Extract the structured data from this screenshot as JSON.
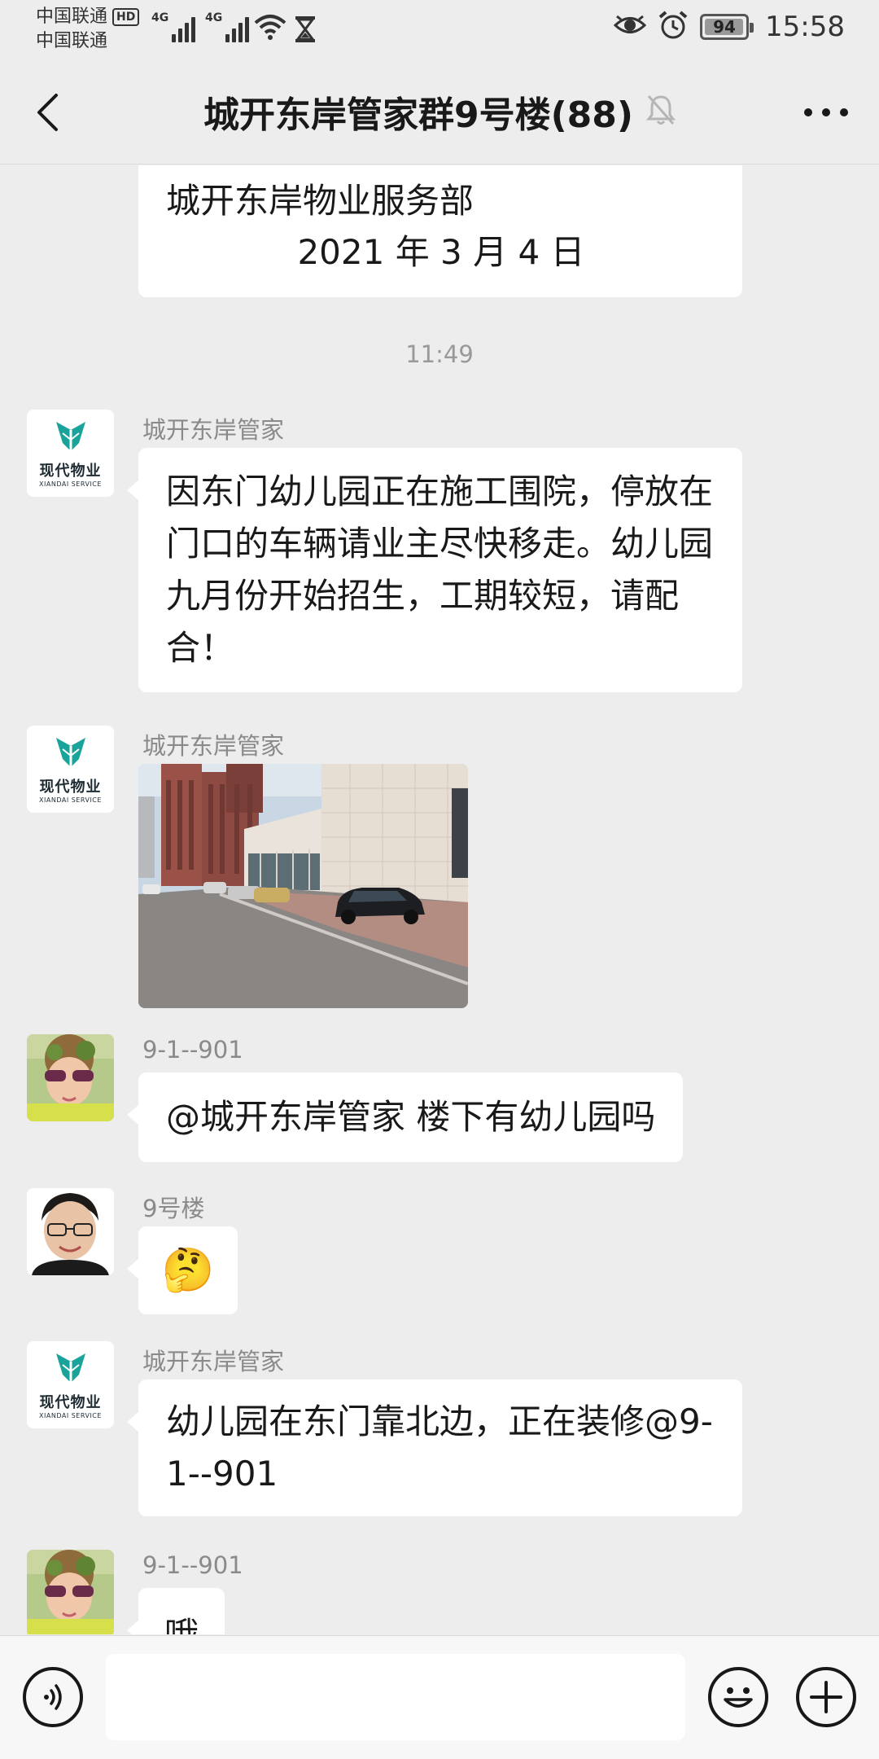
{
  "status_bar": {
    "carrier_1": "中国联通",
    "carrier_badge": "HD",
    "carrier_2": "中国联通",
    "network_1": "4G",
    "network_2": "4G",
    "battery_level": "94",
    "time": "15:58",
    "icons": [
      "signal-icon",
      "wifi-icon",
      "hourglass-icon",
      "eye-icon",
      "alarm-icon",
      "battery-icon"
    ]
  },
  "header": {
    "title": "城开东岸管家群9号楼(88)",
    "muted_icon": "bell-off-icon",
    "back_icon": "chevron-left-icon",
    "more_icon": "more-icon"
  },
  "messages": {
    "notice_signature": "城开东岸物业服务部",
    "notice_date": "2021 年 3 月 4 日",
    "time_divider": "11:49",
    "m1": {
      "sender": "城开东岸管家",
      "avatar_text": "现代物业",
      "avatar_subtext": "XIANDAI SERVICE",
      "text": "因东门幼儿园正在施工围院，停放在门口的车辆请业主尽快移走。幼儿园九月份开始招生，工期较短，请配合！"
    },
    "m2": {
      "sender": "城开东岸管家",
      "avatar_text": "现代物业",
      "avatar_subtext": "XIANDAI SERVICE"
    },
    "m3": {
      "sender": "9-1--901",
      "text": "@城开东岸管家  楼下有幼儿园吗"
    },
    "m4": {
      "sender": "9号楼",
      "emoji": "🤔"
    },
    "m5": {
      "sender": "城开东岸管家",
      "avatar_text": "现代物业",
      "avatar_subtext": "XIANDAI SERVICE",
      "text": "幼儿园在东门靠北边，正在装修@9-1--901"
    },
    "m6": {
      "sender": "9-1--901",
      "text": "哦"
    }
  },
  "input_bar": {
    "voice_icon": "voice-icon",
    "input_value": "",
    "emoji_icon": "emoji-icon",
    "plus_icon": "plus-icon"
  },
  "colors": {
    "background": "#ededed",
    "bubble": "#ffffff",
    "logo_teal": "#1aa39a"
  }
}
